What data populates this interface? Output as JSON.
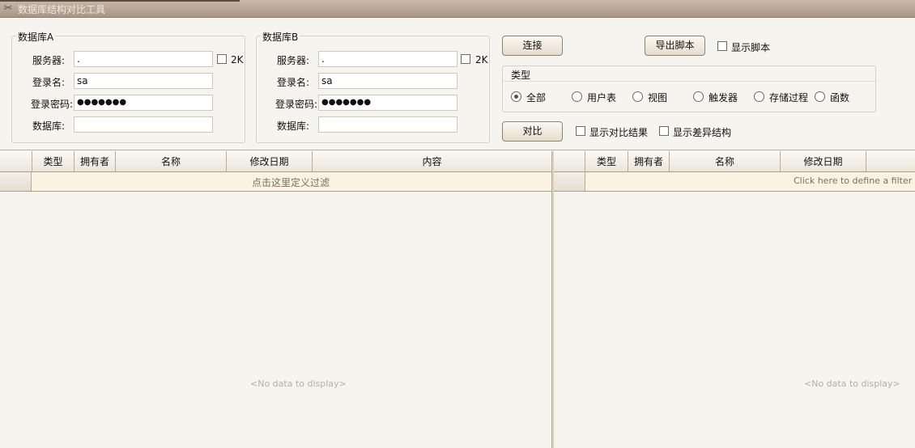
{
  "window": {
    "title": "数据库结构对比工具",
    "icon": "app-tools-icon"
  },
  "dbA": {
    "legend": "数据库A",
    "server_label": "服务器:",
    "server_value": ".",
    "twok_label": "2K",
    "login_label": "登录名:",
    "login_value": "sa",
    "password_label": "登录密码:",
    "password_value": "●●●●●●●",
    "database_label": "数据库:",
    "database_value": ""
  },
  "dbB": {
    "legend": "数据库B",
    "server_label": "服务器:",
    "server_value": ".",
    "twok_label": "2K",
    "login_label": "登录名:",
    "login_value": "sa",
    "password_label": "登录密码:",
    "password_value": "●●●●●●●",
    "database_label": "数据库:",
    "database_value": ""
  },
  "actions": {
    "connect": "连接",
    "export_script": "导出脚本",
    "show_script": "显示脚本",
    "compare": "对比",
    "show_compare_result": "显示对比结果",
    "show_diff_structure": "显示差异结构"
  },
  "types": {
    "legend": "类型",
    "options": [
      "全部",
      "用户表",
      "视图",
      "触发器",
      "存储过程",
      "函数"
    ],
    "selected": "全部"
  },
  "left_grid": {
    "columns": [
      "类型",
      "拥有者",
      "名称",
      "修改日期",
      "内容"
    ],
    "filter_text": "点击这里定义过滤",
    "empty_text": "<No data to display>"
  },
  "right_grid": {
    "columns": [
      "类型",
      "拥有者",
      "名称",
      "修改日期"
    ],
    "filter_text": "Click here to define a filter",
    "empty_text": "<No data to display>"
  }
}
